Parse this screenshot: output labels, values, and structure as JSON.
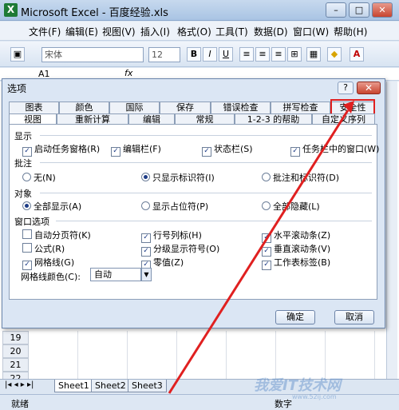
{
  "app": {
    "title": "Microsoft Excel - 百度经验.xls",
    "icon": "excel-icon"
  },
  "window_buttons": [
    "–",
    "□",
    "✕"
  ],
  "menu": [
    "文件(F)",
    "编辑(E)",
    "视图(V)",
    "插入(I)",
    "格式(O)",
    "工具(T)",
    "数据(D)",
    "窗口(W)",
    "帮助(H)"
  ],
  "toolbar": {
    "font": "宋体",
    "size": "12",
    "bold": "B",
    "italic": "I",
    "underline": "U"
  },
  "formula_bar": {
    "name_box": "A1",
    "fx": "fx"
  },
  "rows": [
    "19",
    "20",
    "21",
    "22"
  ],
  "sheet_tabs": [
    "Sheet1",
    "Sheet2",
    "Sheet3"
  ],
  "status": {
    "ready": "就绪",
    "num": "数字"
  },
  "watermark": {
    "main": "我爱IT技术网",
    "sub": "www.52ij.com"
  },
  "dialog": {
    "title": "选项",
    "help": "?",
    "close": "✕",
    "tabs_back": [
      "图表",
      "颜色",
      "国际",
      "保存",
      "错误检查",
      "拼写检查",
      "安全性"
    ],
    "tabs_front": [
      "视图",
      "重新计算",
      "编辑",
      "常规",
      "1-2-3 的帮助",
      "自定义序列"
    ],
    "sections": {
      "show": "显示",
      "comments": "批注",
      "objects": "对象",
      "window": "窗口选项"
    },
    "show_opts": [
      "启动任务窗格(R)",
      "编辑栏(F)",
      "状态栏(S)",
      "任务栏中的窗口(W)"
    ],
    "comment_opts": [
      "无(N)",
      "只显示标识符(I)",
      "批注和标识符(D)"
    ],
    "object_opts": [
      "全部显示(A)",
      "显示占位符(P)",
      "全部隐藏(L)"
    ],
    "window_opts": [
      "自动分页符(K)",
      "行号列标(H)",
      "水平滚动条(Z)",
      "公式(R)",
      "分级显示符号(O)",
      "垂直滚动条(V)",
      "网格线(G)",
      "零值(Z)",
      "工作表标签(B)"
    ],
    "gridline_color_label": "网格线颜色(C):",
    "gridline_color_value": "自动",
    "ok": "确定",
    "cancel": "取消"
  },
  "colors": {
    "highlight": "#e02020",
    "arrow": "#e02020"
  }
}
